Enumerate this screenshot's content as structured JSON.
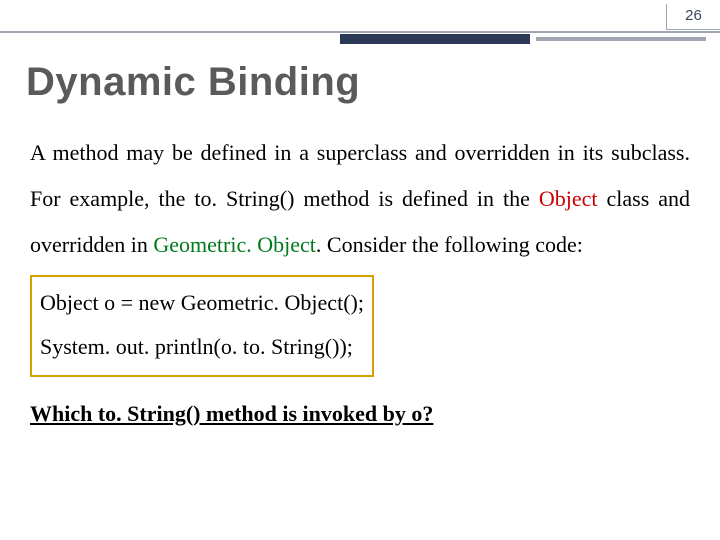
{
  "slide_number": "26",
  "title": "Dynamic Binding",
  "para": {
    "t1": "A method may be defined in a superclass and overridden in its subclass. For example, the to. String() method is defined in the ",
    "obj": "Object",
    "t2": " class and overridden in ",
    "geo": "Geometric. Object",
    "t3": ". Consider the following code:"
  },
  "code": {
    "l1": "Object o = new Geometric. Object();",
    "l2": "System. out. println(o. to. String());"
  },
  "question": "Which to. String() method is invoked by o?"
}
